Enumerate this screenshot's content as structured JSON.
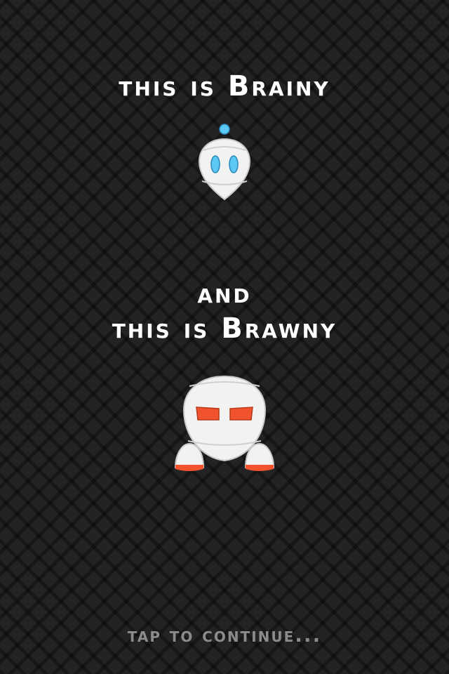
{
  "intro": {
    "brainy_prefix": "this is ",
    "brainy_name": "Brainy",
    "and_text": "and",
    "brawny_prefix": "this is ",
    "brawny_name": "Brawny"
  },
  "characters": [
    {
      "name": "Brainy",
      "eye_color": "#5bc8f5",
      "antenna_color": "#5bc8f5",
      "body_color": "#f2f2f2"
    },
    {
      "name": "Brawny",
      "eye_color": "#f0532d",
      "feet_color": "#f0532d",
      "body_color": "#f2f2f2"
    }
  ],
  "footer": {
    "tap_hint": "Tap to continue..."
  },
  "colors": {
    "background": "#222324",
    "text": "#ffffff",
    "hint_text": "#8a8b8d"
  }
}
